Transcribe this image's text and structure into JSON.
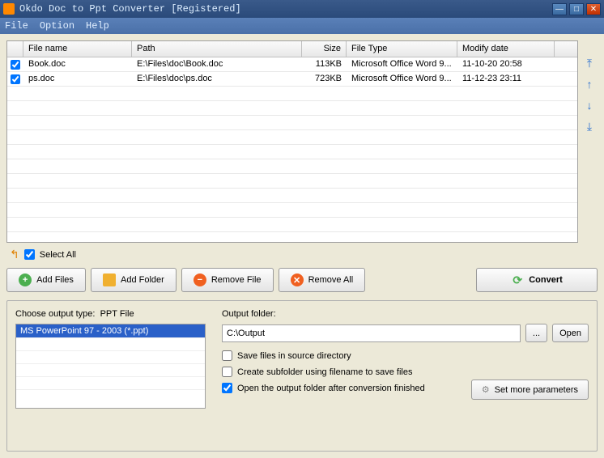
{
  "title": "Okdo Doc to Ppt Converter [Registered]",
  "menu": {
    "file": "File",
    "option": "Option",
    "help": "Help"
  },
  "grid": {
    "headers": {
      "name": "File name",
      "path": "Path",
      "size": "Size",
      "type": "File Type",
      "date": "Modify date"
    },
    "rows": [
      {
        "checked": true,
        "name": "Book.doc",
        "path": "E:\\Files\\doc\\Book.doc",
        "size": "113KB",
        "type": "Microsoft Office Word 9...",
        "date": "11-10-20 20:58"
      },
      {
        "checked": true,
        "name": "ps.doc",
        "path": "E:\\Files\\doc\\ps.doc",
        "size": "723KB",
        "type": "Microsoft Office Word 9...",
        "date": "11-12-23 23:11"
      }
    ]
  },
  "selectAll": {
    "label": "Select All",
    "checked": true
  },
  "buttons": {
    "addFiles": "Add Files",
    "addFolder": "Add Folder",
    "removeFile": "Remove File",
    "removeAll": "Remove All",
    "convert": "Convert"
  },
  "outputType": {
    "label": "Choose output type:",
    "current": "PPT File",
    "items": [
      "MS PowerPoint 97 - 2003 (*.ppt)"
    ]
  },
  "outputFolder": {
    "label": "Output folder:",
    "value": "C:\\Output",
    "browse": "...",
    "open": "Open"
  },
  "options": {
    "saveSource": "Save files in source directory",
    "createSub": "Create subfolder using filename to save files",
    "openAfter": "Open the output folder after conversion finished",
    "saveSourceChecked": false,
    "createSubChecked": false,
    "openAfterChecked": true
  },
  "moreParams": "Set more parameters"
}
